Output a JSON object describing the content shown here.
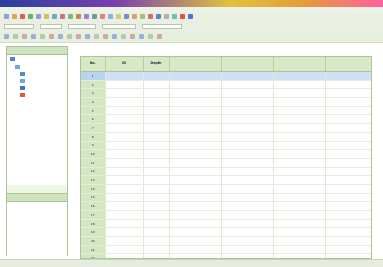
{
  "window": {
    "title": ""
  },
  "toolbar1": {
    "icon_colors": [
      "#8aa0d8",
      "#e2a44c",
      "#e05a5a",
      "#6ab06a",
      "#9a9ad8",
      "#d8c050",
      "#70a8d0",
      "#d0709a",
      "#80b880",
      "#c08a50",
      "#a080d0",
      "#60a0a0",
      "#e08080",
      "#90b0e0",
      "#d0d070",
      "#7090c0",
      "#e0a070",
      "#a0c080",
      "#d07070",
      "#6080d0",
      "#b0b0b0",
      "#70c0b0",
      "#e05050",
      "#5070e0"
    ]
  },
  "toolbar2": {
    "items": [
      "",
      "",
      "",
      "",
      ""
    ]
  },
  "sidebar": {
    "header": "",
    "tree_items": [
      {
        "label": "",
        "icon_color": "#5a7fd0"
      },
      {
        "label": "",
        "icon_color": "#6aa8e0"
      },
      {
        "label": "",
        "icon_color": "#4a90d0"
      },
      {
        "label": "",
        "icon_color": "#6aa8e0"
      },
      {
        "label": "",
        "icon_color": "#4a70c0"
      },
      {
        "label": "",
        "icon_color": "#e05a3a"
      }
    ],
    "pane2_header": ""
  },
  "grid": {
    "columns": [
      "No.",
      "ID",
      "Depth",
      "",
      "",
      "",
      ""
    ],
    "rows": [
      [
        "1",
        "",
        "",
        "",
        "",
        "",
        ""
      ],
      [
        "2",
        "",
        "",
        "",
        "",
        "",
        ""
      ],
      [
        "3",
        "",
        "",
        "",
        "",
        "",
        ""
      ],
      [
        "4",
        "",
        "",
        "",
        "",
        "",
        ""
      ],
      [
        "5",
        "",
        "",
        "",
        "",
        "",
        ""
      ],
      [
        "6",
        "",
        "",
        "",
        "",
        "",
        ""
      ],
      [
        "7",
        "",
        "",
        "",
        "",
        "",
        ""
      ],
      [
        "8",
        "",
        "",
        "",
        "",
        "",
        ""
      ],
      [
        "9",
        "",
        "",
        "",
        "",
        "",
        ""
      ],
      [
        "10",
        "",
        "",
        "",
        "",
        "",
        ""
      ],
      [
        "11",
        "",
        "",
        "",
        "",
        "",
        ""
      ],
      [
        "12",
        "",
        "",
        "",
        "",
        "",
        ""
      ],
      [
        "13",
        "",
        "",
        "",
        "",
        "",
        ""
      ],
      [
        "14",
        "",
        "",
        "",
        "",
        "",
        ""
      ],
      [
        "15",
        "",
        "",
        "",
        "",
        "",
        ""
      ],
      [
        "16",
        "",
        "",
        "",
        "",
        "",
        ""
      ],
      [
        "17",
        "",
        "",
        "",
        "",
        "",
        ""
      ],
      [
        "18",
        "",
        "",
        "",
        "",
        "",
        ""
      ],
      [
        "19",
        "",
        "",
        "",
        "",
        "",
        ""
      ],
      [
        "20",
        "",
        "",
        "",
        "",
        "",
        ""
      ],
      [
        "21",
        "",
        "",
        "",
        "",
        "",
        ""
      ],
      [
        "22",
        "",
        "",
        "",
        "",
        "",
        ""
      ]
    ],
    "selected_row": 0
  },
  "status": {
    "text": ""
  }
}
